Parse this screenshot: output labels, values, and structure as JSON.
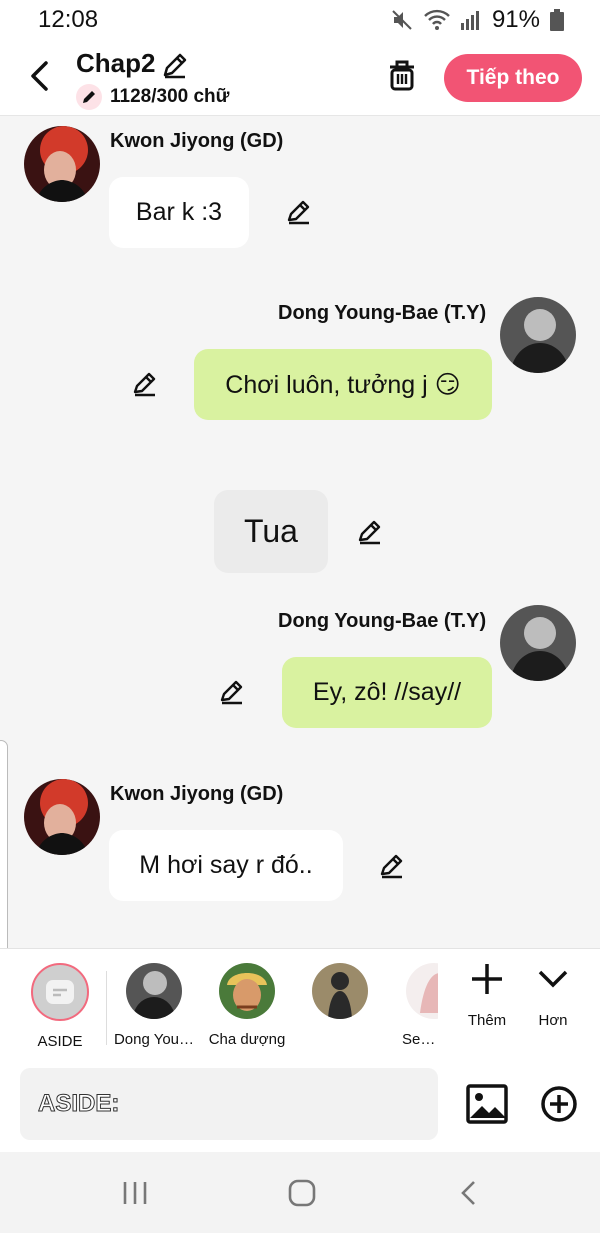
{
  "status": {
    "time": "12:08",
    "battery": "91%"
  },
  "header": {
    "title": "Chap2",
    "word_count": "1128/300 chữ",
    "next_label": "Tiếp theo"
  },
  "messages": [
    {
      "sender": "Kwon Jiyong (GD)",
      "text": "Bar k :3"
    },
    {
      "sender": "Dong Young-Bae (T.Y)",
      "text": "Chơi luôn, tưởng j 😏"
    },
    {
      "text": "Tua"
    },
    {
      "sender": "Dong Young-Bae (T.Y)",
      "text": "Ey, zô! //say//"
    },
    {
      "sender": "Kwon Jiyong (GD)",
      "text": "M hơi say r đó.."
    }
  ],
  "characters": [
    {
      "label": "ASIDE"
    },
    {
      "label": "Dong You…"
    },
    {
      "label": "Cha dượng"
    },
    {
      "label": ""
    },
    {
      "label": "Seo …"
    }
  ],
  "actions": {
    "add_label": "Thêm",
    "more_label": "Hơn"
  },
  "input": {
    "placeholder": "ASIDE:"
  },
  "colors": {
    "accent": "#f25474",
    "bubble_right": "#d9f2a0",
    "bubble_left": "#ffffff"
  }
}
